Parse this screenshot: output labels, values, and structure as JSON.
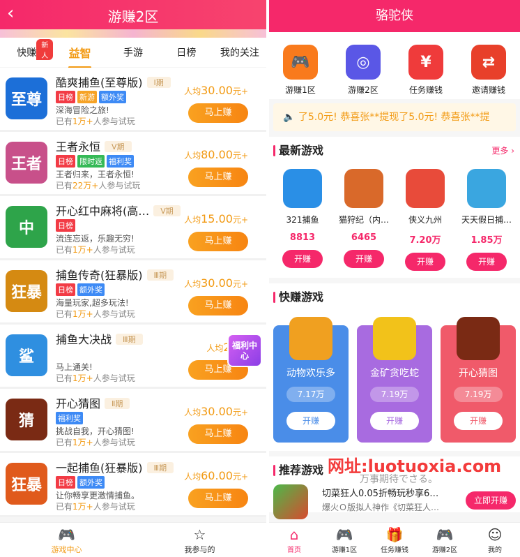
{
  "left": {
    "back_glyph": "‹",
    "title": "游赚2区",
    "tabs": [
      {
        "label": "快赚",
        "badge": "新人"
      },
      {
        "label": "益智"
      },
      {
        "label": "手游"
      },
      {
        "label": "日榜"
      },
      {
        "label": "我的关注"
      }
    ],
    "games": [
      {
        "name": "酷爽捕鱼(至尊版)",
        "period": "Ⅰ期",
        "tags": [
          "日榜",
          "新游",
          "额外奖"
        ],
        "desc": "深海冒险之旅!",
        "count_prefix": "已有",
        "count": "1万+",
        "count_suffix": "人参与试玩",
        "reward_prefix": "人均",
        "reward": "30.00",
        "reward_suffix": "元+",
        "button": "马上赚",
        "icon_text": "至尊",
        "icon_color": "#1c6fd8"
      },
      {
        "name": "王者永恒",
        "period": "Ⅴ期",
        "tags": [
          "日榜",
          "限时返",
          "福利奖"
        ],
        "desc": "王者归来，王者永恒!",
        "count_prefix": "已有",
        "count": "22万+",
        "count_suffix": "人参与试玩",
        "reward_prefix": "人均",
        "reward": "80.00",
        "reward_suffix": "元+",
        "button": "马上赚",
        "icon_text": "王者",
        "icon_color": "#c8508a"
      },
      {
        "name": "开心红中麻将(高…",
        "period": "Ⅴ期",
        "tags": [
          "日榜"
        ],
        "desc": "流连忘返，乐趣无穷!",
        "count_prefix": "已有",
        "count": "1万+",
        "count_suffix": "人参与试玩",
        "reward_prefix": "人均",
        "reward": "15.00",
        "reward_suffix": "元+",
        "button": "马上赚",
        "icon_text": "中",
        "icon_color": "#2ea44a"
      },
      {
        "name": "捕鱼传奇(狂暴版)",
        "period": "Ⅲ期",
        "tags": [
          "日榜",
          "额外奖"
        ],
        "desc": "海量玩家,超多玩法!",
        "count_prefix": "已有",
        "count": "1万+",
        "count_suffix": "人参与试玩",
        "reward_prefix": "人均",
        "reward": "30.00",
        "reward_suffix": "元+",
        "button": "马上赚",
        "icon_text": "狂暴",
        "icon_color": "#d58a12"
      },
      {
        "name": "捕鱼大决战",
        "period": "Ⅲ期",
        "tags": [],
        "desc": "马上通关!",
        "count_prefix": "已有",
        "count": "1万+",
        "count_suffix": "人参与试玩",
        "reward_prefix": "人均",
        "reward": "20.0",
        "reward_suffix": "",
        "button": "马上赚",
        "icon_text": "鲨",
        "icon_color": "#2f8fe0"
      },
      {
        "name": "开心猜图",
        "period": "Ⅱ期",
        "tags": [
          "福利奖"
        ],
        "desc": "挑战自我，开心猜图!",
        "count_prefix": "已有",
        "count": "1万+",
        "count_suffix": "人参与试玩",
        "reward_prefix": "人均",
        "reward": "30.00",
        "reward_suffix": "元+",
        "button": "马上赚",
        "icon_text": "猜",
        "icon_color": "#7a2a14"
      },
      {
        "name": "一起捕鱼(狂暴版)",
        "period": "Ⅲ期",
        "tags": [
          "日榜",
          "额外奖"
        ],
        "desc": "让你畅享更激情捕鱼。",
        "count_prefix": "已有",
        "count": "1万+",
        "count_suffix": "人参与试玩",
        "reward_prefix": "人均",
        "reward": "60.00",
        "reward_suffix": "元+",
        "button": "马上赚",
        "icon_text": "狂暴",
        "icon_color": "#e05a1c"
      }
    ],
    "float_badge": "福利中心",
    "nav": [
      {
        "label": "游戏中心",
        "icon": "gamepad-icon"
      },
      {
        "label": "我参与的",
        "icon": "star-icon"
      }
    ]
  },
  "right": {
    "title": "骆驼侠",
    "quicknav": [
      {
        "label": "游赚1区",
        "icon": "gamepad-icon",
        "color": "#f97a1c"
      },
      {
        "label": "游赚2区",
        "icon": "controller-icon",
        "color": "#5a57e6"
      },
      {
        "label": "任务赚钱",
        "icon": "yen-icon",
        "color": "#ef3b3b"
      },
      {
        "label": "邀请赚钱",
        "icon": "invite-icon",
        "color": "#e8402a"
      }
    ],
    "notice": "🔈 了5.0元!  恭喜张**提现了5.0元!  恭喜张**提",
    "new_games": {
      "title": "最新游戏",
      "more": "更多",
      "items": [
        {
          "name": "321捕鱼",
          "value": "8813",
          "button": "开赚",
          "color": "#2a8fe6"
        },
        {
          "name": "猫狩纪（内…",
          "value": "6465",
          "button": "开赚",
          "color": "#d9692a"
        },
        {
          "name": "侠义九州",
          "value": "7.20万",
          "button": "开赚",
          "color": "#e84b3a"
        },
        {
          "name": "天天假日捕…",
          "value": "1.85万",
          "button": "开赚",
          "color": "#3aa6e0"
        }
      ]
    },
    "fast_games": {
      "title": "快赚游戏",
      "items": [
        {
          "name": "动物欢乐多",
          "value": "7.17万",
          "button": "开赚",
          "bg": "#4a8de8",
          "icon_color": "#f0a020",
          "btn_color": "#4a8de8"
        },
        {
          "name": "金矿贪吃蛇",
          "value": "7.19万",
          "button": "开赚",
          "bg": "#a86be0",
          "icon_color": "#f2c21a",
          "btn_color": "#a86be0"
        },
        {
          "name": "开心猜图",
          "value": "7.19万",
          "button": "开赚",
          "bg": "#f05a6a",
          "icon_color": "#7a2a14",
          "btn_color": "#f05a6a"
        }
      ]
    },
    "recommend": {
      "title": "推荐游戏",
      "watermark": "网址:luotuoxia.com",
      "watermark2": "万事期待でさる。",
      "item_title": "切菜狂人0.05折畅玩秒享6…",
      "item_sub": "爆火Ｏ版拟人神作《切菜狂人…",
      "button": "立即开赚"
    },
    "nav": [
      {
        "label": "首页",
        "icon": "home-icon"
      },
      {
        "label": "游赚1区",
        "icon": "gamepad-icon"
      },
      {
        "label": "任务赚钱",
        "icon": "gift-icon"
      },
      {
        "label": "游赚2区",
        "icon": "gamepad-icon"
      },
      {
        "label": "我的",
        "icon": "user-icon"
      }
    ]
  }
}
